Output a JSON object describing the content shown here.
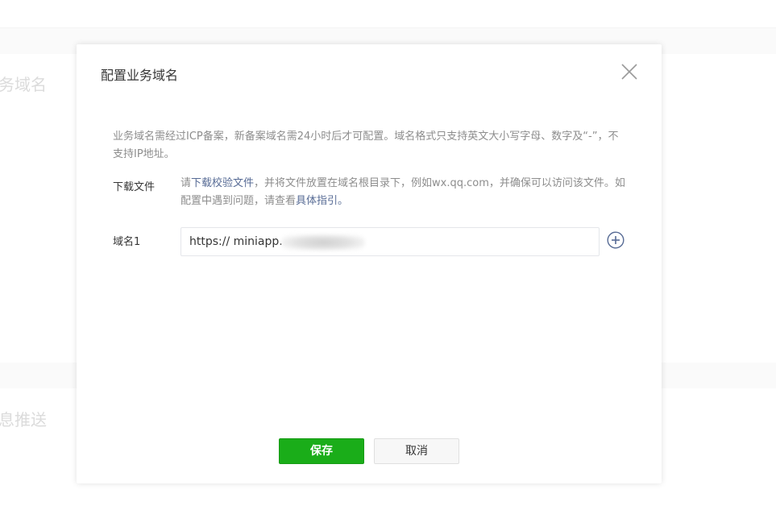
{
  "background": {
    "section_1_title": "务域名",
    "section_2_title": "息推送"
  },
  "dialog": {
    "title": "配置业务域名",
    "close_icon": "close-icon",
    "notice": "业务域名需经过ICP备案，新备案域名需24小时后才可配置。域名格式只支持英文大小写字母、数字及“-”，不支持IP地址。",
    "download": {
      "label": "下载文件",
      "text_1": "请",
      "link_1": "下载校验文件",
      "text_2": "，并将文件放置在域名根目录下，例如wx.qq.com，并确保可以访问该文件。如配置中遇到问题，请查看",
      "link_2": "具体指引。"
    },
    "domain": {
      "label": "域名1",
      "value": "https:// miniapp.",
      "add_icon": "plus-circle-icon"
    },
    "buttons": {
      "save": "保存",
      "cancel": "取消"
    }
  },
  "colors": {
    "primary": "#1aad19",
    "link": "#576b95",
    "text": "#353535",
    "muted": "#8d8d8d"
  }
}
